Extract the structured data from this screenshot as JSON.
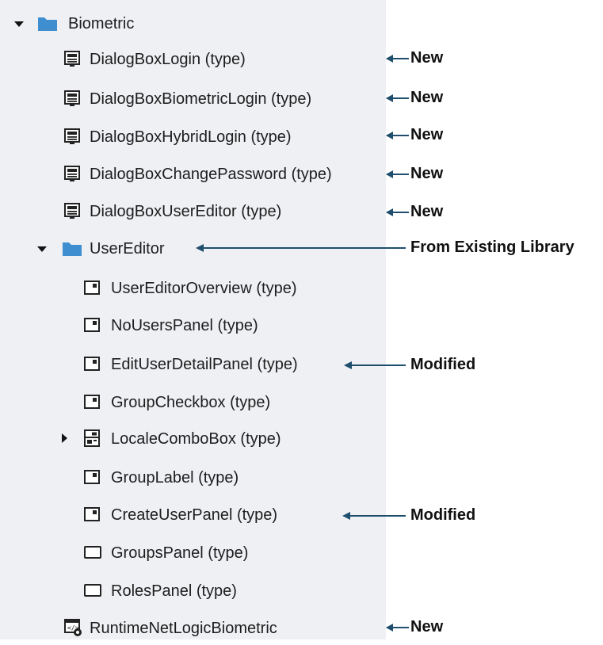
{
  "colors": {
    "panel_bg": "#eef0f4",
    "folder": "#3f8fd0",
    "arrow": "#1f4e6d"
  },
  "tree": {
    "root": {
      "label": "Biometric",
      "icon": "folder-icon",
      "expanded": true
    },
    "items": [
      {
        "label": "DialogBoxLogin (type)",
        "icon": "dialog-box-icon"
      },
      {
        "label": "DialogBoxBiometricLogin (type)",
        "icon": "dialog-box-icon"
      },
      {
        "label": "DialogBoxHybridLogin (type)",
        "icon": "dialog-box-icon"
      },
      {
        "label": "DialogBoxChangePassword (type)",
        "icon": "dialog-box-icon"
      },
      {
        "label": "DialogBoxUserEditor (type)",
        "icon": "dialog-box-icon"
      }
    ],
    "folder": {
      "label": "UserEditor",
      "icon": "folder-icon",
      "expanded": true
    },
    "children": [
      {
        "label": "UserEditorOverview (type)",
        "icon": "panel-type-icon"
      },
      {
        "label": "NoUsersPanel (type)",
        "icon": "panel-type-icon"
      },
      {
        "label": "EditUserDetailPanel (type)",
        "icon": "panel-type-icon"
      },
      {
        "label": "GroupCheckbox (type)",
        "icon": "panel-type-icon"
      },
      {
        "label": "LocaleComboBox (type)",
        "icon": "combobox-icon",
        "expanded": false
      },
      {
        "label": "GroupLabel (type)",
        "icon": "panel-type-icon"
      },
      {
        "label": "CreateUserPanel (type)",
        "icon": "panel-type-icon"
      },
      {
        "label": "GroupsPanel (type)",
        "icon": "rectangle-icon"
      },
      {
        "label": "RolesPanel (type)",
        "icon": "rectangle-icon"
      }
    ],
    "last": {
      "label": "RuntimeNetLogicBiometric",
      "icon": "netlogic-icon"
    }
  },
  "annotations": {
    "dialog_login": "New",
    "dialog_biometric": "New",
    "dialog_hybrid": "New",
    "dialog_change_password": "New",
    "dialog_user_editor": "New",
    "user_editor_folder": "From Existing Library",
    "edit_user_detail": "Modified",
    "create_user": "Modified",
    "netlogic": "New"
  }
}
